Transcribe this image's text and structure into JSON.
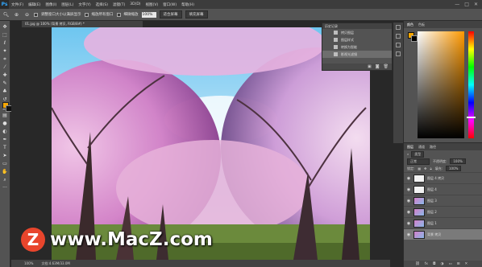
{
  "menubar": {
    "logo": "Ps",
    "items": [
      "文件(F)",
      "编辑(E)",
      "图像(I)",
      "图层(L)",
      "文字(Y)",
      "选择(S)",
      "滤镜(T)",
      "3D(D)",
      "视图(V)",
      "窗口(W)",
      "帮助(H)"
    ],
    "controls": [
      "—",
      "□",
      "✕"
    ]
  },
  "options": {
    "resize_label": "调整窗口大小以满屏显示",
    "zoom_all_label": "缩放所有窗口",
    "scrubby_label": "细微缩放",
    "zoom_value": "100%",
    "fit_screen": "适合屏幕",
    "fill_screen": "填充屏幕"
  },
  "document": {
    "tab": "01.jpg @ 100% (背景 拷贝, RGB/8#) *",
    "zoom_status": "100%",
    "doc_status": "文档:4.63M/33.0M"
  },
  "history": {
    "title": "历史记录",
    "items": [
      "拷贝图层",
      "图层样式",
      "转换为智能",
      "影视光滤镜"
    ]
  },
  "color_panel": {
    "tabs": [
      "颜色",
      "色板"
    ],
    "foreground": "#f7a700",
    "background": "#000000"
  },
  "layers": {
    "tabs": [
      "图层",
      "通道",
      "路径"
    ],
    "filter": "类型",
    "blend_mode": "正常",
    "opacity_label": "不透明度:",
    "opacity": "100%",
    "lock_label": "锁定:",
    "fill_label": "填充:",
    "fill": "100%",
    "items": [
      {
        "name": "图层 4 拷贝",
        "thumb": "white"
      },
      {
        "name": "图层 4",
        "thumb": "white"
      },
      {
        "name": "图层 3",
        "thumb": "photo"
      },
      {
        "name": "图层 2",
        "thumb": "photo"
      },
      {
        "name": "图层 1",
        "thumb": "photo"
      },
      {
        "name": "背景 拷贝",
        "thumb": "photo"
      }
    ]
  },
  "watermark": {
    "badge": "Z",
    "text": "www.MacZ.com"
  }
}
